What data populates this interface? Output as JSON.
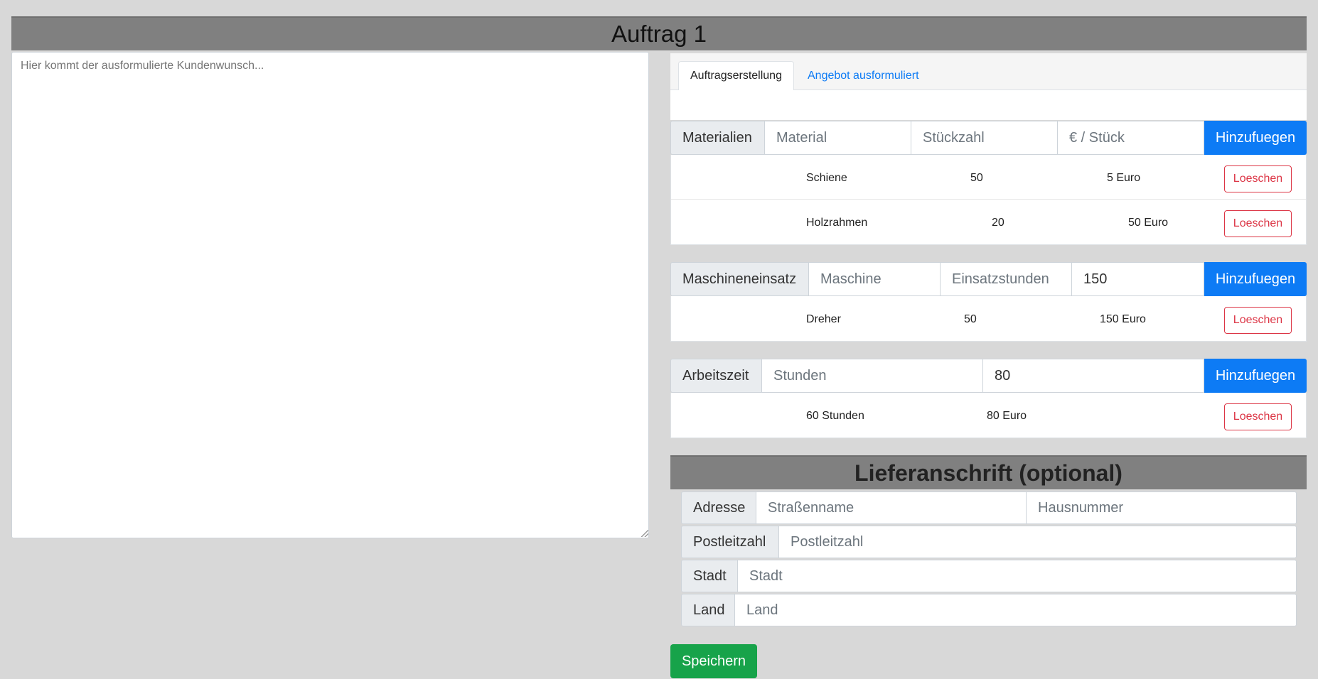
{
  "header": {
    "title": "Auftrag 1"
  },
  "customer_request": {
    "placeholder": "Hier kommt der ausformulierte Kundenwunsch..."
  },
  "tabs": [
    {
      "label": "Auftragserstellung",
      "active": true
    },
    {
      "label": "Angebot ausformuliert",
      "active": false
    }
  ],
  "materials": {
    "label": "Materialien",
    "inputs": {
      "material": "Material",
      "quantity": "Stückzahl",
      "price": "€ / Stück"
    },
    "add_label": "Hinzufuegen",
    "rows": [
      {
        "name": "Schiene",
        "qty": "50",
        "price": "5 Euro",
        "delete": "Loeschen"
      },
      {
        "name": "Holzrahmen",
        "qty": "20",
        "price": "50 Euro",
        "delete": "Loeschen"
      }
    ]
  },
  "machines": {
    "label": "Maschineneinsatz",
    "inputs": {
      "machine": "Maschine",
      "hours": "Einsatzstunden",
      "rate_value": "150"
    },
    "add_label": "Hinzufuegen",
    "rows": [
      {
        "name": "Dreher",
        "hours": "50",
        "price": "150 Euro",
        "delete": "Loeschen"
      }
    ]
  },
  "worktime": {
    "label": "Arbeitszeit",
    "inputs": {
      "hours": "Stunden",
      "rate_value": "80"
    },
    "add_label": "Hinzufuegen",
    "rows": [
      {
        "hours": "60 Stunden",
        "price": "80 Euro",
        "delete": "Loeschen"
      }
    ]
  },
  "delivery": {
    "title": "Lieferanschrift (optional)",
    "address_label": "Adresse",
    "street_placeholder": "Straßenname",
    "number_placeholder": "Hausnummer",
    "zip_label": "Postleitzahl",
    "zip_placeholder": "Postleitzahl",
    "city_label": "Stadt",
    "city_placeholder": "Stadt",
    "country_label": "Land",
    "country_placeholder": "Land"
  },
  "save_label": "Speichern",
  "colors": {
    "primary": "#0d7bf5",
    "danger": "#dc3545",
    "success": "#17a34a",
    "header_bg": "#808080"
  }
}
